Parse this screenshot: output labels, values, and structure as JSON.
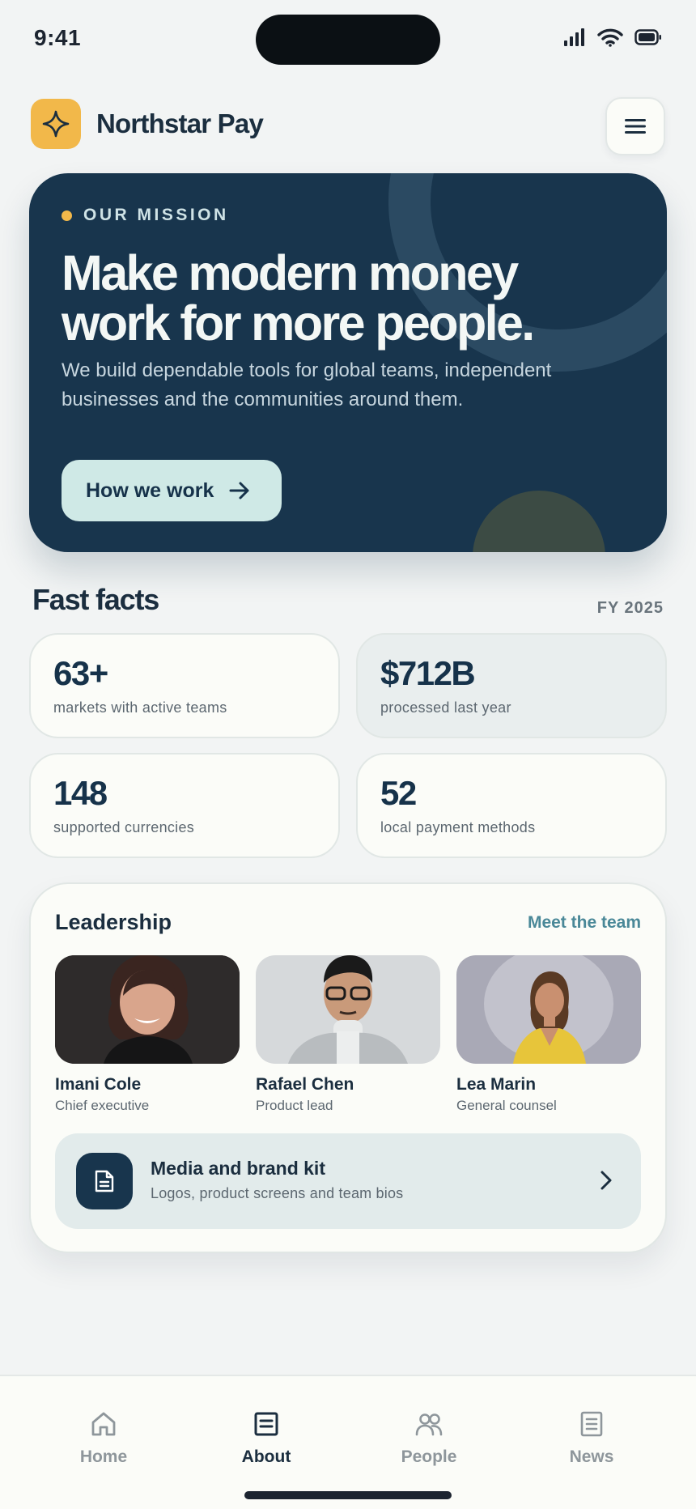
{
  "status_bar": {
    "time": "9:41"
  },
  "header": {
    "brand": "Northstar Pay",
    "logo_icon": "sparkle-icon",
    "menu_icon": "hamburger-icon"
  },
  "hero": {
    "eyebrow": "OUR MISSION",
    "title": "Make modern money work for more people.",
    "description": "We build dependable tools for global teams, independent businesses and the communities around them.",
    "cta_label": "How we work",
    "cta_icon": "arrow-right-icon"
  },
  "facts": {
    "title": "Fast facts",
    "period": "FY 2025",
    "items": [
      {
        "value": "63+",
        "label": "markets with active teams"
      },
      {
        "value": "$712B",
        "label": "processed last year"
      },
      {
        "value": "148",
        "label": "supported currencies"
      },
      {
        "value": "52",
        "label": "local payment methods"
      }
    ]
  },
  "leadership": {
    "title": "Leadership",
    "link": "Meet the team",
    "people": [
      {
        "name": "Imani Cole",
        "role": "Chief executive"
      },
      {
        "name": "Rafael Chen",
        "role": "Product lead"
      },
      {
        "name": "Lea Marin",
        "role": "General counsel"
      }
    ],
    "media": {
      "title": "Media and brand kit",
      "subtitle": "Logos, product screens and team bios",
      "icon": "document-icon"
    }
  },
  "nav": {
    "active": "About",
    "tabs": [
      {
        "label": "Home",
        "icon": "home-icon"
      },
      {
        "label": "About",
        "icon": "about-icon"
      },
      {
        "label": "People",
        "icon": "people-icon"
      },
      {
        "label": "News",
        "icon": "news-icon"
      }
    ]
  },
  "colors": {
    "brand_navy": "#18354d",
    "accent_yellow": "#f2b84a",
    "mint": "#cfe9e6",
    "link_teal": "#4a8898"
  }
}
